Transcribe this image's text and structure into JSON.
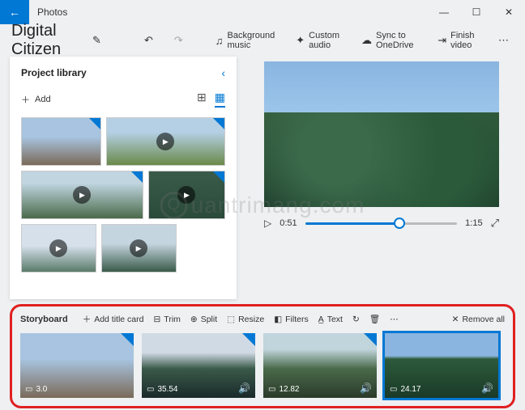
{
  "titlebar": {
    "app_name": "Photos"
  },
  "project": {
    "name": "Digital Citizen"
  },
  "toolbar": {
    "bg_music": "Background music",
    "custom_audio": "Custom audio",
    "sync": "Sync to OneDrive",
    "finish": "Finish video"
  },
  "library": {
    "title": "Project library",
    "add": "Add"
  },
  "preview": {
    "current_time": "0:51",
    "total_time": "1:15"
  },
  "storyboard": {
    "title": "Storyboard",
    "add_title": "Add title card",
    "trim": "Trim",
    "split": "Split",
    "resize": "Resize",
    "filters": "Filters",
    "text": "Text",
    "remove_all": "Remove all",
    "clips": [
      {
        "duration": "3.0",
        "type": "image"
      },
      {
        "duration": "35.54",
        "type": "video"
      },
      {
        "duration": "12.82",
        "type": "video"
      },
      {
        "duration": "24.17",
        "type": "video",
        "selected": true
      }
    ]
  },
  "watermark": "uantrimang.com"
}
